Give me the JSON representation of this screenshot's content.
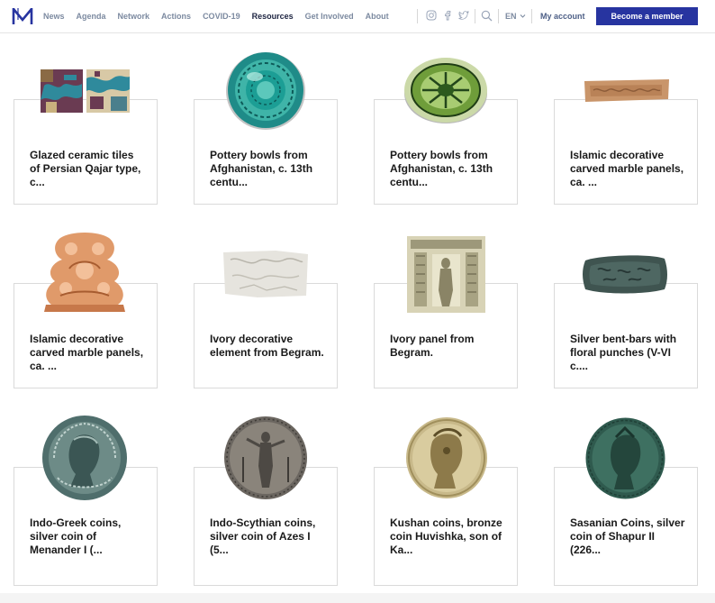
{
  "nav": {
    "items": [
      "News",
      "Agenda",
      "Network",
      "Actions",
      "COVID-19",
      "Resources",
      "Get Involved",
      "About"
    ],
    "active": "Resources"
  },
  "header": {
    "language": "EN",
    "account": "My account",
    "cta": "Become a member"
  },
  "colors": {
    "brand": "#2734a0",
    "nav_text": "#7c8aa0",
    "nav_active": "#1c2340"
  },
  "cards": [
    {
      "title": "Glazed ceramic tiles of Persian Qajar type, c...",
      "image": "persian-tiles"
    },
    {
      "title": "Pottery bowls from Afghanistan, c. 13th centu...",
      "image": "turquoise-bowl"
    },
    {
      "title": "Pottery bowls from Afghanistan, c. 13th centu...",
      "image": "green-bowl"
    },
    {
      "title": "Islamic decorative carved marble panels, ca. ...",
      "image": "marble-strip"
    },
    {
      "title": "Islamic decorative carved marble panels, ca. ...",
      "image": "terracotta-ornament"
    },
    {
      "title": "Ivory decorative element from Begram.",
      "image": "ivory-element"
    },
    {
      "title": "Ivory panel from Begram.",
      "image": "ivory-panel"
    },
    {
      "title": "Silver bent-bars with floral punches (V-VI c....",
      "image": "silver-bar"
    },
    {
      "title": "Indo-Greek coins, silver coin of Menander I (...",
      "image": "indo-greek-coin"
    },
    {
      "title": "Indo-Scythian coins, silver coin of Azes I (5...",
      "image": "indo-scythian-coin"
    },
    {
      "title": "Kushan coins, bronze coin Huvishka, son of Ka...",
      "image": "kushan-coin"
    },
    {
      "title": "Sasanian Coins, silver coin of Shapur II (226...",
      "image": "sasanian-coin"
    }
  ]
}
